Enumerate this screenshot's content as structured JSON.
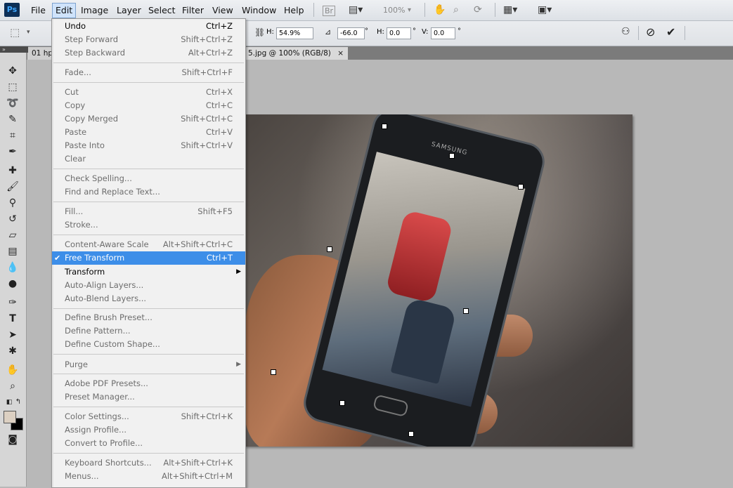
{
  "app": {
    "logo": "Ps"
  },
  "menubar": {
    "items": [
      "File",
      "Edit",
      "Image",
      "Layer",
      "Select",
      "Filter",
      "View",
      "Window",
      "Help"
    ],
    "bridge": "Br",
    "zoom": "100%"
  },
  "options": {
    "h_label": "H:",
    "h_value": "54.9%",
    "angle_value": "-66.0",
    "hskew_label": "H:",
    "hskew_value": "0.0",
    "vskew_label": "V:",
    "vskew_value": "0.0",
    "degree": "°"
  },
  "tabs": {
    "tab1": "01 hp",
    "tab2": "5.jpg @ 100% (RGB/8)",
    "close": "×"
  },
  "edit_menu": {
    "items": [
      {
        "label": "Undo",
        "shortcut": "Ctrl+Z"
      },
      {
        "label": "Step Forward",
        "shortcut": "Shift+Ctrl+Z"
      },
      {
        "label": "Step Backward",
        "shortcut": "Alt+Ctrl+Z"
      },
      {
        "label": "Fade...",
        "shortcut": "Shift+Ctrl+F"
      },
      {
        "label": "Cut",
        "shortcut": "Ctrl+X"
      },
      {
        "label": "Copy",
        "shortcut": "Ctrl+C"
      },
      {
        "label": "Copy Merged",
        "shortcut": "Shift+Ctrl+C"
      },
      {
        "label": "Paste",
        "shortcut": "Ctrl+V"
      },
      {
        "label": "Paste Into",
        "shortcut": "Shift+Ctrl+V"
      },
      {
        "label": "Clear",
        "shortcut": ""
      },
      {
        "label": "Check Spelling...",
        "shortcut": ""
      },
      {
        "label": "Find and Replace Text...",
        "shortcut": ""
      },
      {
        "label": "Fill...",
        "shortcut": "Shift+F5"
      },
      {
        "label": "Stroke...",
        "shortcut": ""
      },
      {
        "label": "Content-Aware Scale",
        "shortcut": "Alt+Shift+Ctrl+C"
      },
      {
        "label": "Free Transform",
        "shortcut": "Ctrl+T"
      },
      {
        "label": "Transform",
        "shortcut": ""
      },
      {
        "label": "Auto-Align Layers...",
        "shortcut": ""
      },
      {
        "label": "Auto-Blend Layers...",
        "shortcut": ""
      },
      {
        "label": "Define Brush Preset...",
        "shortcut": ""
      },
      {
        "label": "Define Pattern...",
        "shortcut": ""
      },
      {
        "label": "Define Custom Shape...",
        "shortcut": ""
      },
      {
        "label": "Purge",
        "shortcut": ""
      },
      {
        "label": "Adobe PDF Presets...",
        "shortcut": ""
      },
      {
        "label": "Preset Manager...",
        "shortcut": ""
      },
      {
        "label": "Color Settings...",
        "shortcut": "Shift+Ctrl+K"
      },
      {
        "label": "Assign Profile...",
        "shortcut": ""
      },
      {
        "label": "Convert to Profile...",
        "shortcut": ""
      },
      {
        "label": "Keyboard Shortcuts...",
        "shortcut": "Alt+Shift+Ctrl+K"
      },
      {
        "label": "Menus...",
        "shortcut": "Alt+Shift+Ctrl+M"
      }
    ]
  },
  "canvas": {
    "phone_brand": "SAMSUNG"
  },
  "colors": {
    "highlight": "#3d8ee8",
    "menu_bg": "#f1f1f1"
  }
}
